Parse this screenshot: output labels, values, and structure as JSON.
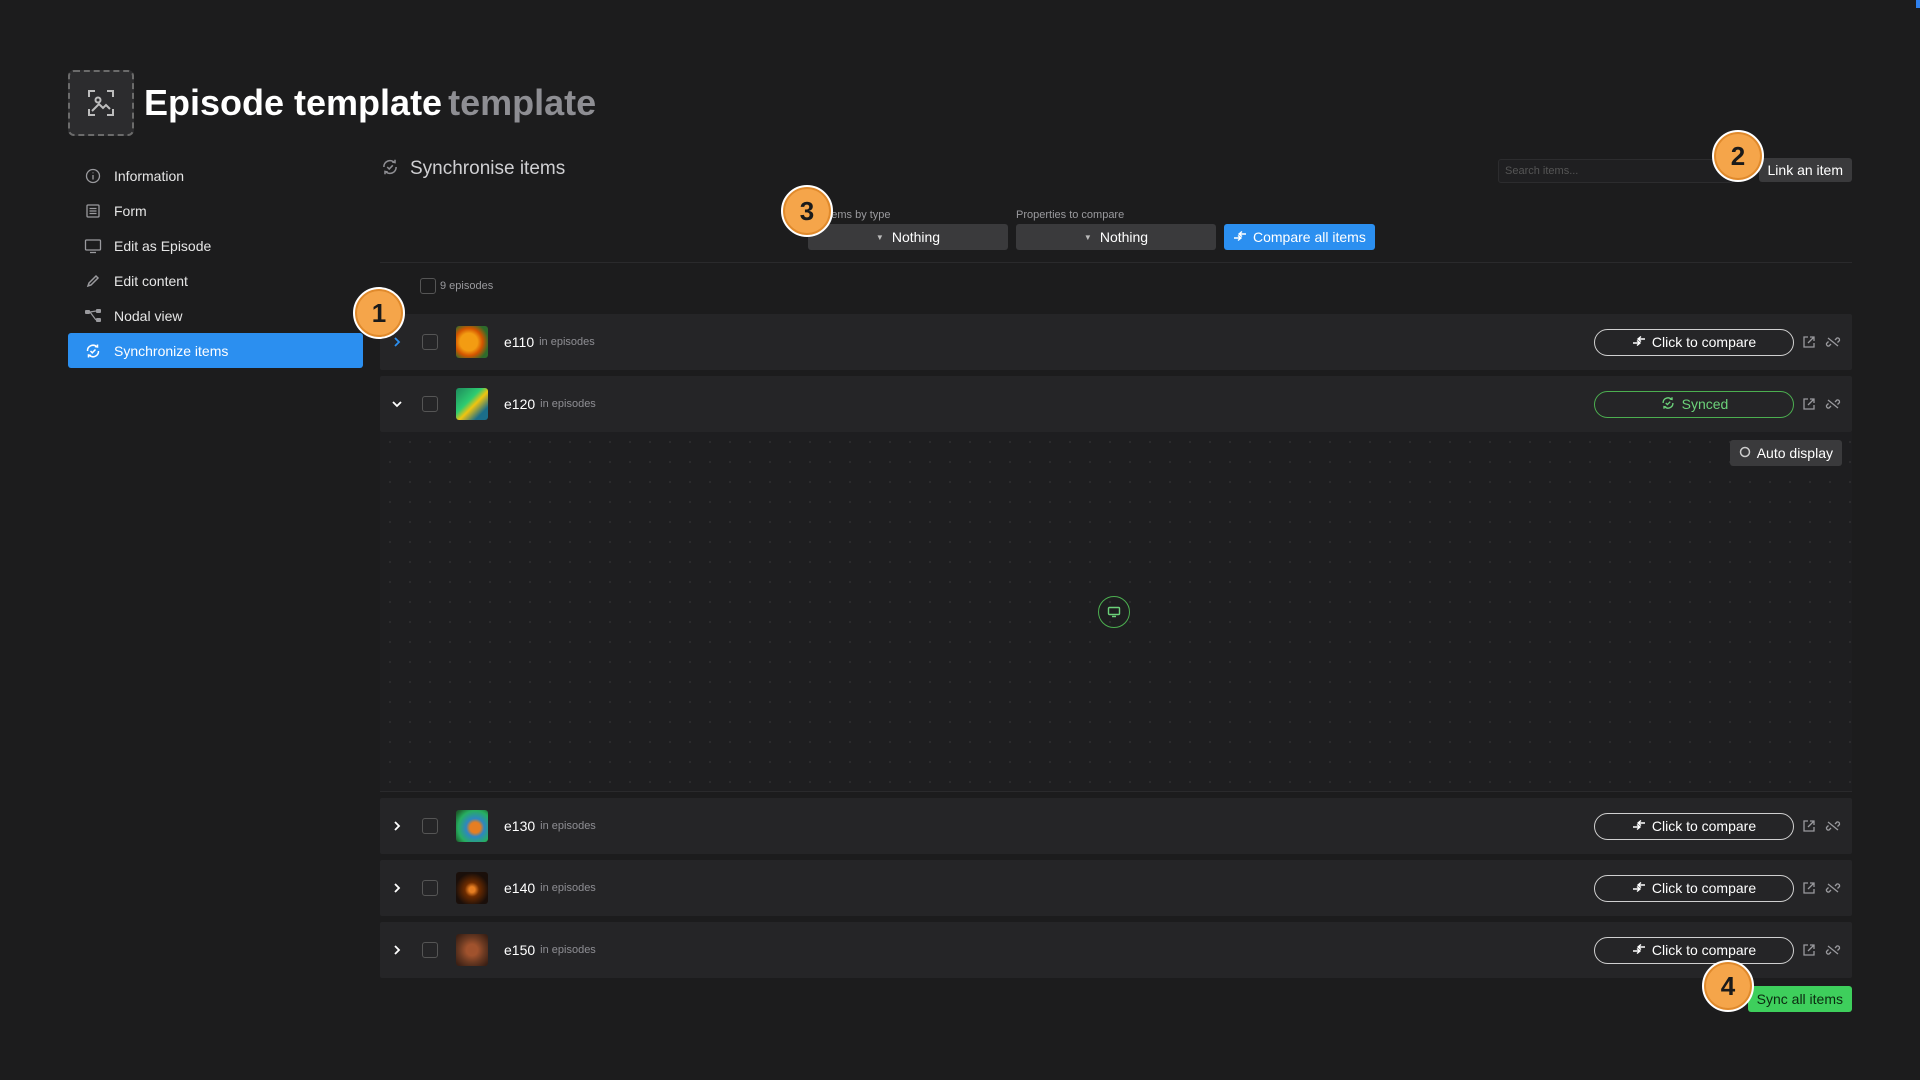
{
  "header": {
    "title": "Episode template",
    "title_suffix": "template",
    "avatar_icon": "image-placeholder-icon"
  },
  "sidebar": {
    "items": [
      {
        "label": "Information",
        "icon": "info-icon",
        "active": false
      },
      {
        "label": "Form",
        "icon": "form-icon",
        "active": false
      },
      {
        "label": "Edit as Episode",
        "icon": "monitor-icon",
        "active": false
      },
      {
        "label": "Edit content",
        "icon": "pencil-icon",
        "active": false
      },
      {
        "label": "Nodal view",
        "icon": "nodes-icon",
        "active": false
      },
      {
        "label": "Synchronize items",
        "icon": "sync-icon",
        "active": true
      }
    ]
  },
  "main": {
    "section_title": "Synchronise items",
    "search_placeholder": "Search items...",
    "link_button": "Link an item",
    "filter_type_label": "ide items by type",
    "filter_type_value": "Nothing",
    "filter_props_label": "Properties to compare",
    "filter_props_value": "Nothing",
    "compare_all_button": "Compare all items",
    "count_label": "9 episodes",
    "rows": [
      {
        "name": "e110",
        "sub": "in episodes",
        "status": "Click to compare",
        "expanded": false
      },
      {
        "name": "e120",
        "sub": "in episodes",
        "status": "Synced",
        "expanded": true
      },
      {
        "name": "e130",
        "sub": "in episodes",
        "status": "Click to compare",
        "expanded": false
      },
      {
        "name": "e140",
        "sub": "in episodes",
        "status": "Click to compare",
        "expanded": false
      },
      {
        "name": "e150",
        "sub": "in episodes",
        "status": "Click to compare",
        "expanded": false
      }
    ],
    "auto_display_button": "Auto display",
    "sync_all_button": "Sync all items"
  },
  "badges": [
    "1",
    "2",
    "3",
    "4"
  ],
  "colors": {
    "accent": "#2b8ff0",
    "synced": "#4caf50",
    "sync_all": "#3ecf5c",
    "badge": "#f5a54a"
  }
}
